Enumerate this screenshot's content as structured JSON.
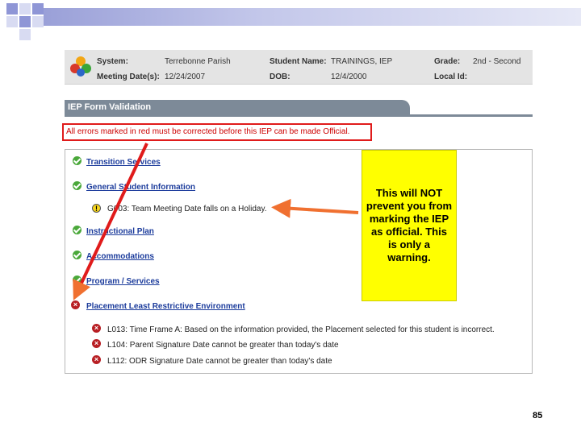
{
  "header": {
    "system_label": "System:",
    "system_value": "Terrebonne Parish",
    "student_label": "Student Name:",
    "student_value": "TRAININGS, IEP",
    "grade_label": "Grade:",
    "grade_value": "2nd - Second",
    "meeting_label": "Meeting Date(s):",
    "meeting_value": "12/24/2007",
    "dob_label": "DOB:",
    "dob_value": "12/4/2000",
    "localid_label": "Local Id:",
    "localid_value": ""
  },
  "section_title": "IEP Form Validation",
  "error_notice": "All errors marked in red must be corrected before this IEP can be made Official.",
  "items": [
    {
      "label": "Transition Services",
      "status": "ok"
    },
    {
      "label": "General Student Information",
      "status": "ok"
    },
    {
      "label": "G003: Team Meeting Date falls on a Holiday.",
      "status": "warning"
    },
    {
      "label": "Instructional Plan",
      "status": "ok"
    },
    {
      "label": "Accommodations",
      "status": "ok"
    },
    {
      "label": "Program / Services",
      "status": "ok"
    },
    {
      "label": "Placement Least Restrictive Environment",
      "status": "error"
    },
    {
      "label": "L013: Time Frame A: Based on the information provided, the Placement selected for this student is incorrect.",
      "status": "error"
    },
    {
      "label": "L104: Parent Signature Date cannot be greater than today's date",
      "status": "error"
    },
    {
      "label": "L112: ODR Signature Date cannot be greater than today's date",
      "status": "error"
    }
  ],
  "callout_text": "This will NOT prevent you from marking the IEP as official. This is only a warning.",
  "page_number": "85",
  "colors": {
    "error": "#e01b1b",
    "callout": "#ffff00",
    "arrow": "#f07030",
    "link": "#1c3c9c"
  }
}
